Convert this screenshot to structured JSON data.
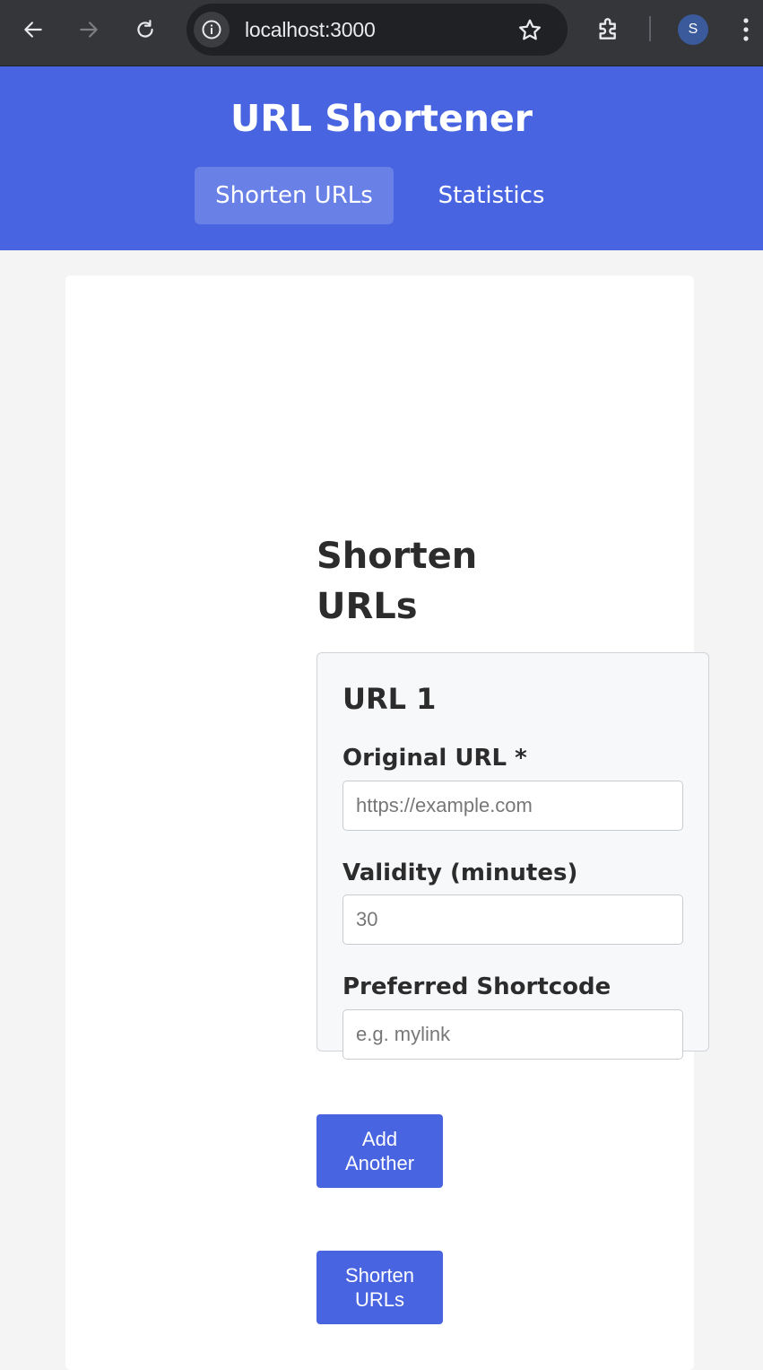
{
  "browser": {
    "url": "localhost:3000",
    "profile_initial": "S"
  },
  "app": {
    "title": "URL Shortener",
    "tabs": [
      {
        "label": "Shorten URLs",
        "active": true
      },
      {
        "label": "Statistics",
        "active": false
      }
    ]
  },
  "main": {
    "heading": "Shorten URLs",
    "url_entries": [
      {
        "title": "URL 1",
        "original_url": {
          "label": "Original URL *",
          "placeholder": "https://example.com",
          "value": ""
        },
        "validity": {
          "label": "Validity (minutes)",
          "placeholder": "30",
          "value": ""
        },
        "shortcode": {
          "label": "Preferred Shortcode",
          "placeholder": "e.g. mylink",
          "value": ""
        }
      }
    ],
    "add_another_label": "Add Another",
    "submit_label": "Shorten URLs"
  },
  "colors": {
    "accent": "#4864e1",
    "chrome_bg": "#35363a",
    "page_bg": "#f4f4f4"
  }
}
